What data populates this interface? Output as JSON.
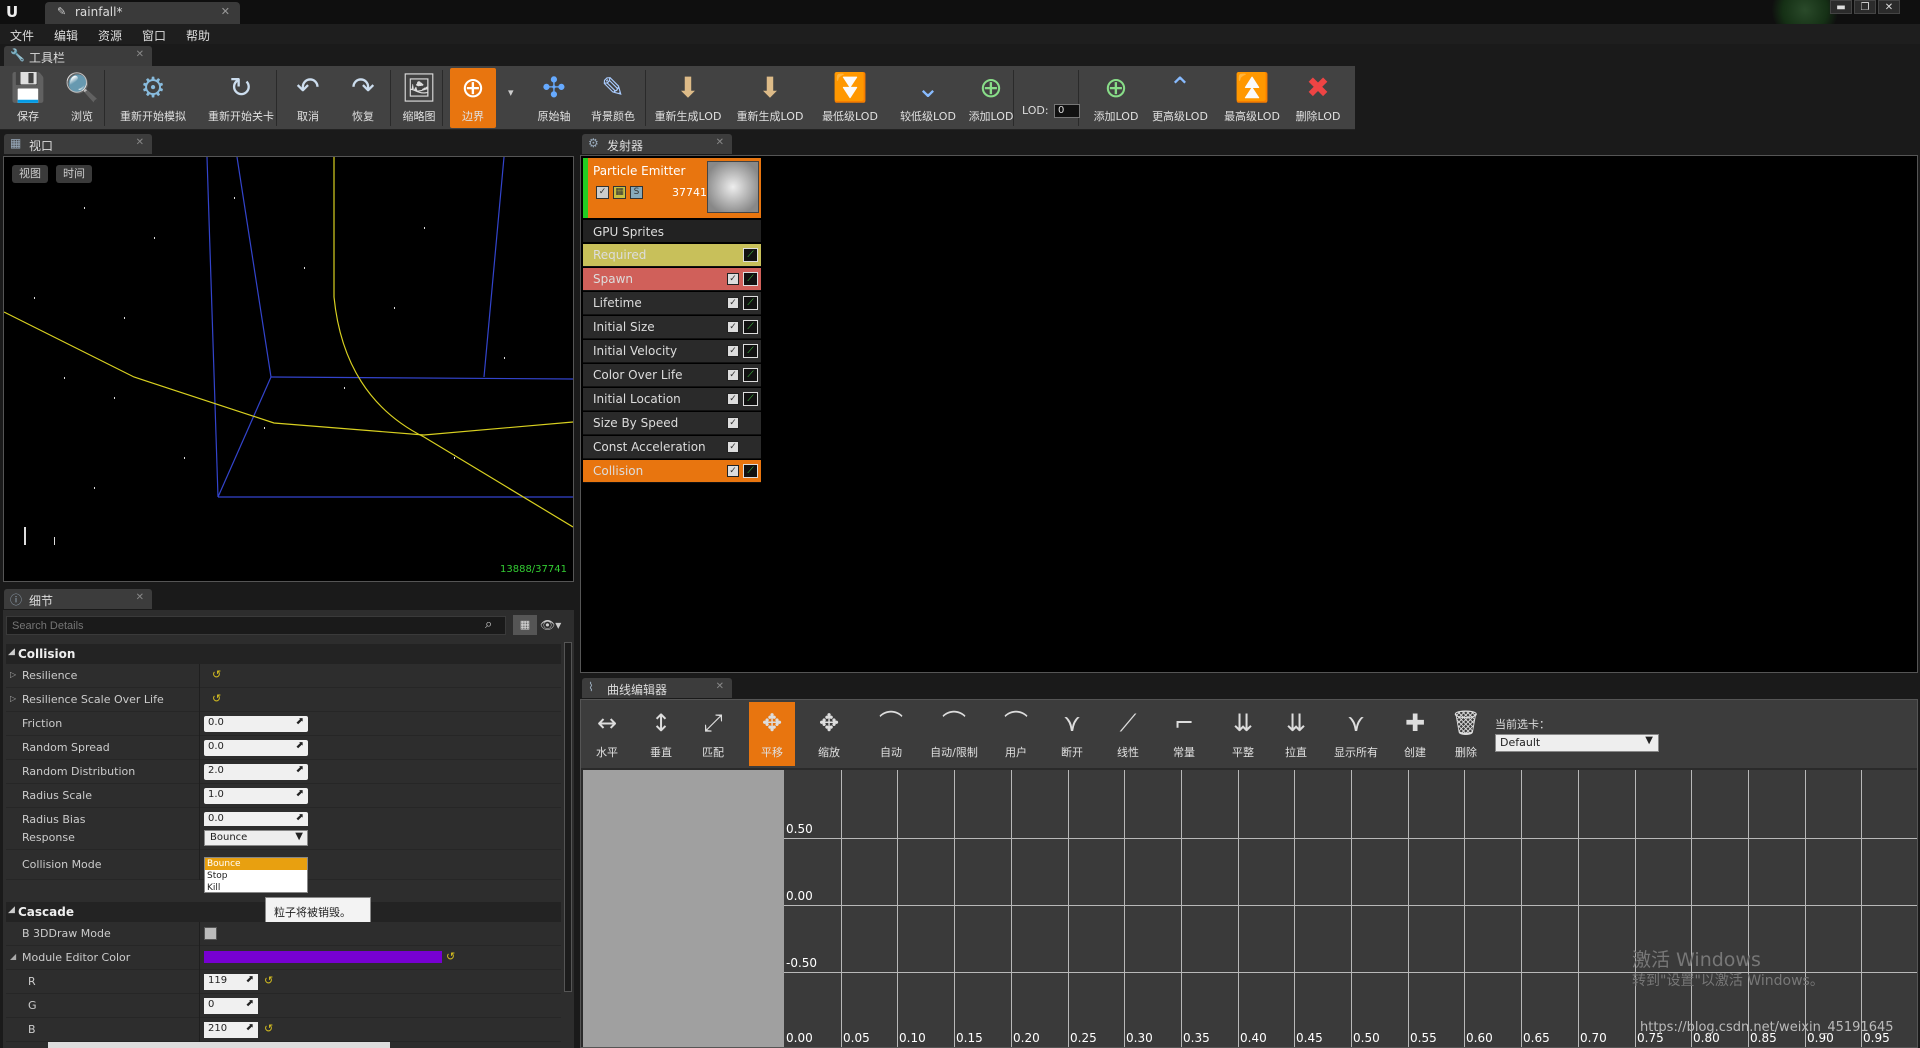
{
  "window": {
    "doc_tab": "rainfall*",
    "min": "▬",
    "max": "❐",
    "close": "✕"
  },
  "menu": [
    "文件",
    "编辑",
    "资源",
    "窗口",
    "帮助"
  ],
  "toolbar_tab": "工具栏",
  "toolbar": [
    {
      "label": "保存",
      "icon": "save-icon",
      "glyph": "💾"
    },
    {
      "label": "浏览",
      "icon": "browse-icon",
      "glyph": "🔍"
    },
    {
      "label": "重新开始模拟",
      "icon": "restart-sim-icon",
      "glyph": "⚙"
    },
    {
      "label": "重新开始关卡",
      "icon": "restart-level-icon",
      "glyph": "↻"
    },
    {
      "label": "取消",
      "icon": "undo-icon",
      "glyph": "↶"
    },
    {
      "label": "恢复",
      "icon": "redo-icon",
      "glyph": "↷"
    },
    {
      "label": "缩略图",
      "icon": "thumbnail-icon",
      "glyph": "🖼"
    },
    {
      "label": "边界",
      "icon": "bounds-icon",
      "glyph": "⊕"
    },
    {
      "label": "原始轴",
      "icon": "origin-axis-icon",
      "glyph": "✣"
    },
    {
      "label": "背景颜色",
      "icon": "bg-color-icon",
      "glyph": "✎"
    },
    {
      "label": "重新生成LOD",
      "icon": "regen-lod-icon",
      "glyph": "⬇"
    },
    {
      "label": "重新生成LOD",
      "icon": "regen-lod2-icon",
      "glyph": "⬇"
    },
    {
      "label": "最低级LOD",
      "icon": "lowest-lod-icon",
      "glyph": "⏬"
    },
    {
      "label": "较低级LOD",
      "icon": "lower-lod-icon",
      "glyph": "⌄"
    },
    {
      "label": "添加LOD",
      "icon": "add-lod-icon",
      "glyph": "⊕"
    },
    {
      "label": "添加LOD",
      "icon": "add-lod2-icon",
      "glyph": "⊕"
    },
    {
      "label": "更高级LOD",
      "icon": "higher-lod-icon",
      "glyph": "⌃"
    },
    {
      "label": "最高级LOD",
      "icon": "highest-lod-icon",
      "glyph": "⏫"
    },
    {
      "label": "删除LOD",
      "icon": "delete-lod-icon",
      "glyph": "✖"
    }
  ],
  "lod": {
    "label": "LOD:",
    "value": "0"
  },
  "viewport": {
    "tab": "视口",
    "view_btn": "视图",
    "time_btn": "时间",
    "stat": "13888/37741"
  },
  "emitter": {
    "tab": "发射器",
    "name": "Particle Emitter",
    "count": "37741",
    "type": "GPU Sprites",
    "modules": [
      {
        "name": "Required",
        "color": "#c8c05a",
        "checkbox": false
      },
      {
        "name": "Spawn",
        "color": "#d0605a",
        "checkbox": true
      },
      {
        "name": "Lifetime",
        "color": "#2a2a2a",
        "checkbox": true
      },
      {
        "name": "Initial Size",
        "color": "#2a2a2a",
        "checkbox": true
      },
      {
        "name": "Initial Velocity",
        "color": "#2a2a2a",
        "checkbox": true
      },
      {
        "name": "Color Over Life",
        "color": "#2a2a2a",
        "checkbox": true
      },
      {
        "name": "Initial Location",
        "color": "#2a2a2a",
        "checkbox": true
      },
      {
        "name": "Size By Speed",
        "color": "#2a2a2a",
        "checkbox": true,
        "nograph": true
      },
      {
        "name": "Const Acceleration",
        "color": "#2a2a2a",
        "checkbox": true,
        "nograph": true
      },
      {
        "name": "Collision",
        "color": "#e8750f",
        "checkbox": true
      }
    ]
  },
  "details": {
    "tab": "细节",
    "search_placeholder": "Search Details",
    "collision_cat": "Collision",
    "props": [
      {
        "name": "Resilience",
        "value": "",
        "expand": true
      },
      {
        "name": "Resilience Scale Over Life",
        "value": "",
        "expand": true
      },
      {
        "name": "Friction",
        "value": "0.0"
      },
      {
        "name": "Random Spread",
        "value": "0.0"
      },
      {
        "name": "Random Distribution",
        "value": "2.0"
      },
      {
        "name": "Radius Scale",
        "value": "1.0"
      },
      {
        "name": "Radius Bias",
        "value": "0.0"
      }
    ],
    "response_label": "Response",
    "response_value": "Bounce",
    "collision_mode_label": "Collision Mode",
    "options": [
      "Bounce",
      "Stop",
      "Kill"
    ],
    "tooltip": "粒子将被销毁。",
    "cascade_cat": "Cascade",
    "b3d_label": "B 3DDraw Mode",
    "module_color_label": "Module Editor Color",
    "module_color": "#7700d2",
    "r_label": "R",
    "r_value": "119",
    "g_label": "G",
    "g_value": "0",
    "b_label": "B",
    "b_value": "210"
  },
  "curve_editor": {
    "tab": "曲线编辑器",
    "buttons": [
      {
        "label": "水平",
        "glyph": "↔"
      },
      {
        "label": "垂直",
        "glyph": "↕"
      },
      {
        "label": "匹配",
        "glyph": "⤢"
      },
      {
        "label": "平移",
        "glyph": "✥",
        "active": true
      },
      {
        "label": "缩放",
        "glyph": "✥"
      },
      {
        "label": "自动",
        "glyph": "⌒"
      },
      {
        "label": "自动/限制",
        "glyph": "⌒"
      },
      {
        "label": "用户",
        "glyph": "⌒"
      },
      {
        "label": "断开",
        "glyph": "⋎"
      },
      {
        "label": "线性",
        "glyph": "⟋"
      },
      {
        "label": "常量",
        "glyph": "⌐"
      },
      {
        "label": "平整",
        "glyph": "⇊"
      },
      {
        "label": "拉直",
        "glyph": "⇊"
      },
      {
        "label": "显示所有",
        "glyph": "⋎"
      },
      {
        "label": "创建",
        "glyph": "✚"
      },
      {
        "label": "删除",
        "glyph": "🗑"
      }
    ],
    "tab_label": "当前选卡：",
    "tab_value": "Default",
    "y_labels": [
      "0.50",
      "0.00",
      "-0.50"
    ],
    "x_labels": [
      "0.00",
      "0.05",
      "0.10",
      "0.15",
      "0.20",
      "0.25",
      "0.30",
      "0.35",
      "0.40",
      "0.45",
      "0.50",
      "0.55",
      "0.60",
      "0.65",
      "0.70",
      "0.75",
      "0.80",
      "0.85",
      "0.90",
      "0.95"
    ]
  },
  "watermark": {
    "line1": "激活 Windows",
    "line2": "转到\"设置\"以激活 Windows。"
  },
  "url": "https://blog.csdn.net/weixin_45191645"
}
